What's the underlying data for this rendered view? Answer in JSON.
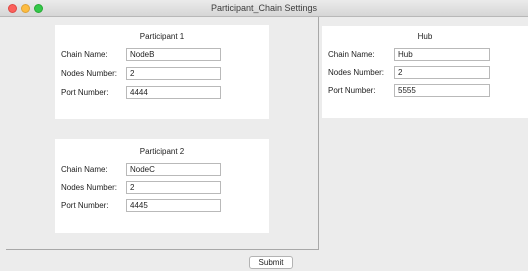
{
  "window": {
    "title": "Participant_Chain Settings"
  },
  "participants": [
    {
      "title": "Participant 1",
      "fields": [
        {
          "label": "Chain Name:",
          "value": "NodeB"
        },
        {
          "label": "Nodes Number:",
          "value": "2"
        },
        {
          "label": "Port Number:",
          "value": "4444"
        }
      ]
    },
    {
      "title": "Participant 2",
      "fields": [
        {
          "label": "Chain Name:",
          "value": "NodeC"
        },
        {
          "label": "Nodes Number:",
          "value": "2"
        },
        {
          "label": "Port Number:",
          "value": "4445"
        }
      ]
    }
  ],
  "hub": {
    "title": "Hub",
    "fields": [
      {
        "label": "Chain Name:",
        "value": "Hub"
      },
      {
        "label": "Nodes Number:",
        "value": "2"
      },
      {
        "label": "Port Number:",
        "value": "5555"
      }
    ]
  },
  "actions": {
    "submit_label": "Submit"
  },
  "colors": {
    "close": "#fc605c",
    "minimize": "#fdbc40",
    "maximize": "#34c84a",
    "panel": "#ffffff",
    "background": "#ececec"
  }
}
